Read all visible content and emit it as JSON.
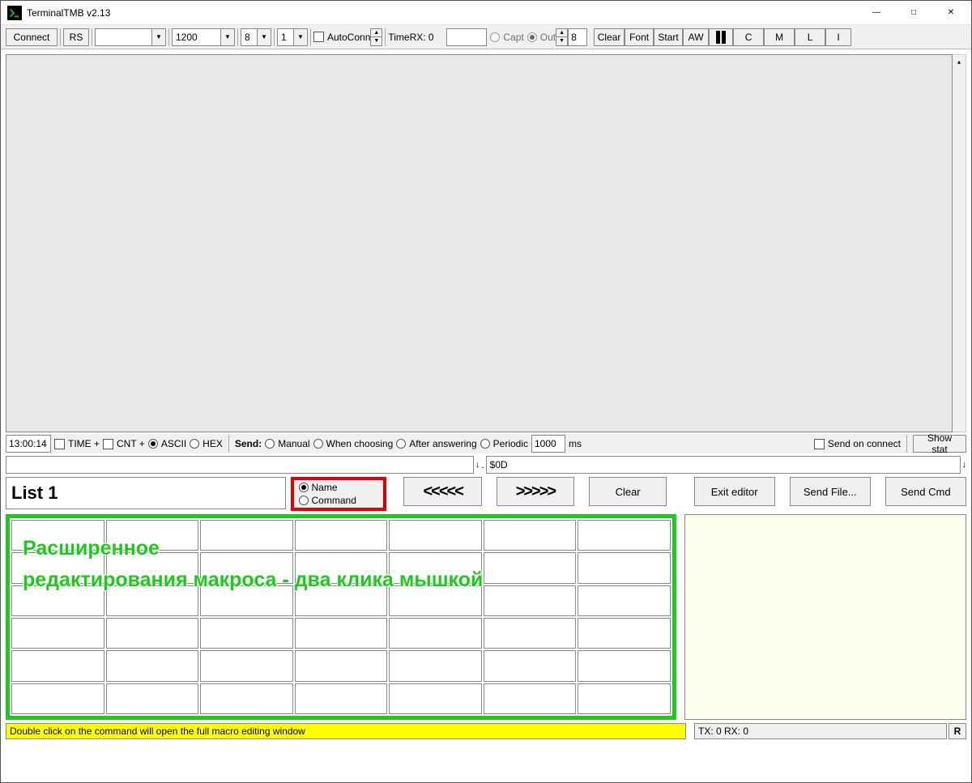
{
  "window": {
    "title": "TerminalTMB v2.13"
  },
  "toolbar": {
    "connect": "Connect",
    "rs": "RS",
    "port": "",
    "baud": "1200",
    "databits": "8",
    "parity": "1",
    "autoconn": "AutoConn",
    "timerx": "TimeRX: 0",
    "capt": "Capt",
    "out": "Out",
    "outval": "8",
    "clear": "Clear",
    "font": "Font",
    "start": "Start",
    "aw": "AW",
    "c": "C",
    "m": "M",
    "l": "L",
    "i": "I"
  },
  "midbar": {
    "time": "13:00:14",
    "time_plus": "TIME +",
    "cnt_plus": "CNT +",
    "ascii": "ASCII",
    "hex": "HEX",
    "send_label": "Send:",
    "manual": "Manual",
    "when_choosing": "When choosing",
    "after_answering": "After answering",
    "periodic": "Periodic",
    "periodic_val": "1000",
    "ms": "ms",
    "send_on_connect": "Send on connect",
    "show_stat": "Show stat"
  },
  "sendline": {
    "suffix": "$0D"
  },
  "editor": {
    "list_title": "List 1",
    "radio_name": "Name",
    "radio_command": "Command",
    "prev": "<<<<<",
    "next": ">>>>>",
    "clear": "Clear",
    "exit": "Exit editor",
    "send_file": "Send File...",
    "send_cmd": "Send Cmd"
  },
  "overlay": {
    "line1": "Расширенное",
    "line2": "редактирования макроса - два клика мышкой"
  },
  "status": {
    "hint": "Double click on the command will open the full macro editing window",
    "txrx": "TX: 0 RX: 0",
    "r": "R"
  }
}
